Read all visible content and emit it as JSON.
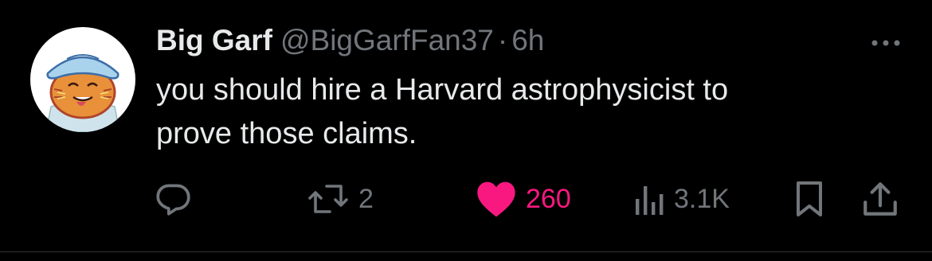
{
  "tweet": {
    "display_name": "Big Garf",
    "handle": "@BigGarfFan37",
    "separator": "·",
    "time": "6h",
    "text": "you should hire a Harvard astrophysicist to\nprove those claims."
  },
  "actions": {
    "reply_icon": "reply-icon",
    "retweet_icon": "retweet-icon",
    "retweet_count": "2",
    "like_icon": "heart-filled-icon",
    "like_count": "260",
    "views_icon": "views-bar-chart-icon",
    "views_count": "3.1K",
    "bookmark_icon": "bookmark-icon",
    "share_icon": "share-icon"
  },
  "colors": {
    "background": "#000000",
    "primary_text": "#e7e9ea",
    "secondary_text": "#71767b",
    "like_pink": "#f91880"
  }
}
